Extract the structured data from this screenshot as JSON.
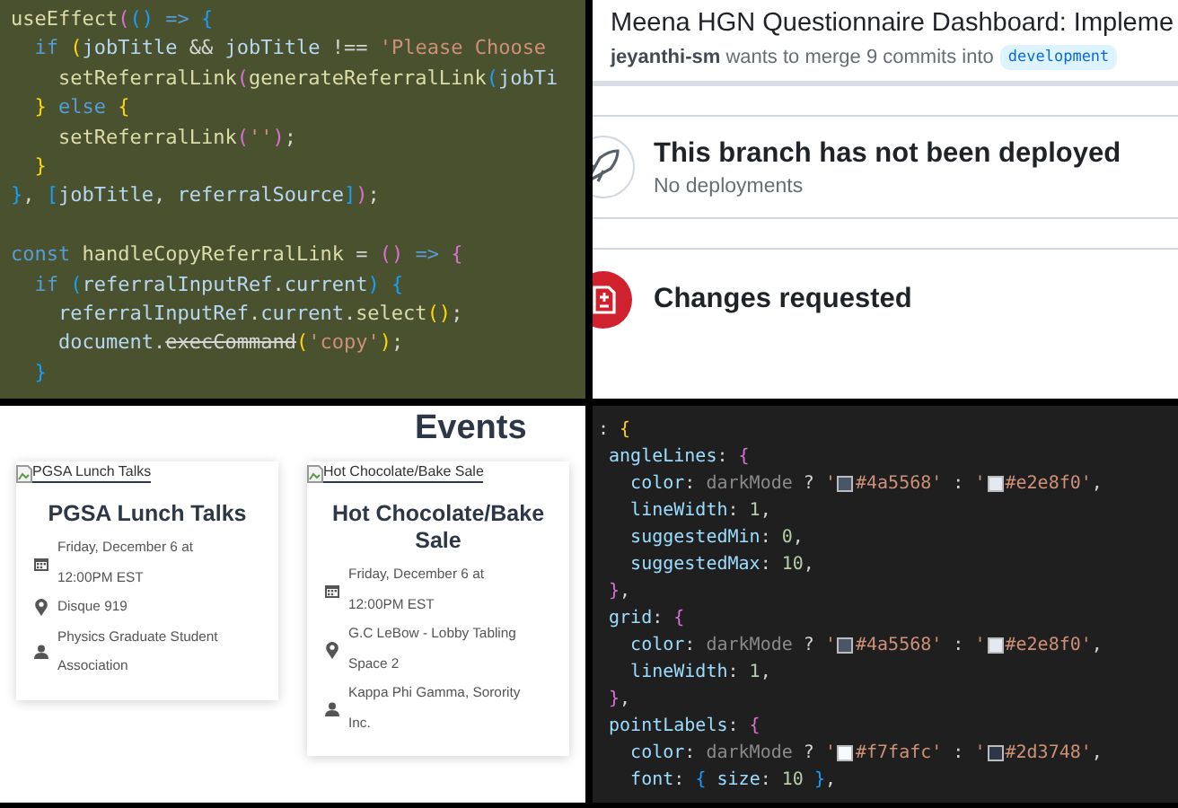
{
  "code_editor_top": {
    "lines": [
      {
        "tokens": [
          {
            "kind": "fn",
            "text": "useEffect"
          },
          {
            "kind": "b2",
            "text": "("
          },
          {
            "kind": "b3",
            "text": "()"
          },
          {
            "kind": "kw",
            "text": " => "
          },
          {
            "kind": "b3",
            "text": "{"
          }
        ]
      },
      {
        "tokens": [
          {
            "kind": "kw",
            "text": "  if "
          },
          {
            "kind": "b1",
            "text": "("
          },
          {
            "kind": "var",
            "text": "jobTitle"
          },
          {
            "kind": "plain",
            "text": " && "
          },
          {
            "kind": "var",
            "text": "jobTitle"
          },
          {
            "kind": "plain",
            "text": " !== "
          },
          {
            "kind": "str",
            "text": "'Please Choose"
          }
        ]
      },
      {
        "tokens": [
          {
            "kind": "fn",
            "text": "    setReferralLink"
          },
          {
            "kind": "b2",
            "text": "("
          },
          {
            "kind": "fn",
            "text": "generateReferralLink"
          },
          {
            "kind": "b3",
            "text": "("
          },
          {
            "kind": "var",
            "text": "jobTi"
          }
        ]
      },
      {
        "tokens": [
          {
            "kind": "b1",
            "text": "  }"
          },
          {
            "kind": "kw",
            "text": " else "
          },
          {
            "kind": "b1",
            "text": "{"
          }
        ]
      },
      {
        "tokens": [
          {
            "kind": "fn",
            "text": "    setReferralLink"
          },
          {
            "kind": "b2",
            "text": "("
          },
          {
            "kind": "str",
            "text": "''"
          },
          {
            "kind": "b2",
            "text": ")"
          },
          {
            "kind": "plain",
            "text": ";"
          }
        ]
      },
      {
        "tokens": [
          {
            "kind": "b1",
            "text": "  }"
          }
        ]
      },
      {
        "tokens": [
          {
            "kind": "b3",
            "text": "}"
          },
          {
            "kind": "plain",
            "text": ", "
          },
          {
            "kind": "b3",
            "text": "["
          },
          {
            "kind": "var",
            "text": "jobTitle"
          },
          {
            "kind": "plain",
            "text": ", "
          },
          {
            "kind": "var",
            "text": "referralSource"
          },
          {
            "kind": "b3",
            "text": "]"
          },
          {
            "kind": "b2",
            "text": ")"
          },
          {
            "kind": "plain",
            "text": ";"
          }
        ]
      },
      {
        "space_before": true,
        "tokens": [
          {
            "kind": "kw",
            "text": "const "
          },
          {
            "kind": "fn",
            "text": "handleCopyReferralLink"
          },
          {
            "kind": "plain",
            "text": " = "
          },
          {
            "kind": "b2",
            "text": "()"
          },
          {
            "kind": "kw",
            "text": " => "
          },
          {
            "kind": "b2",
            "text": "{"
          }
        ]
      },
      {
        "tokens": [
          {
            "kind": "kw",
            "text": "  if "
          },
          {
            "kind": "b3",
            "text": "("
          },
          {
            "kind": "var",
            "text": "referralInputRef"
          },
          {
            "kind": "plain",
            "text": "."
          },
          {
            "kind": "var",
            "text": "current"
          },
          {
            "kind": "b3",
            "text": ")"
          },
          {
            "kind": "b3",
            "text": " {"
          }
        ]
      },
      {
        "tokens": [
          {
            "kind": "var",
            "text": "    referralInputRef"
          },
          {
            "kind": "plain",
            "text": "."
          },
          {
            "kind": "var",
            "text": "current"
          },
          {
            "kind": "plain",
            "text": "."
          },
          {
            "kind": "fn",
            "text": "select"
          },
          {
            "kind": "b1",
            "text": "()"
          },
          {
            "kind": "plain",
            "text": ";"
          }
        ]
      },
      {
        "tokens": [
          {
            "kind": "var",
            "text": "    document"
          },
          {
            "kind": "plain",
            "text": "."
          },
          {
            "kind": "deprecated",
            "text": "execCommand"
          },
          {
            "kind": "b1",
            "text": "("
          },
          {
            "kind": "str",
            "text": "'copy'"
          },
          {
            "kind": "b1",
            "text": ")"
          },
          {
            "kind": "plain",
            "text": ";"
          }
        ]
      },
      {
        "tokens": [
          {
            "kind": "b3",
            "text": "  }"
          }
        ]
      }
    ]
  },
  "pull_request": {
    "title": "Meena HGN Questionnaire Dashboard: Impleme",
    "author": "jeyanthi-sm",
    "merge_text": "wants to merge 9 commits into",
    "branch": "development",
    "sections": [
      {
        "kind": "deploy",
        "title": "This branch has not been deployed",
        "subtitle": "No deployments"
      },
      {
        "kind": "changes",
        "title": "Changes requested"
      }
    ]
  },
  "events": {
    "heading": "Events",
    "cards": [
      {
        "image_alt": "PGSA Lunch Talks",
        "title": "PGSA Lunch Talks",
        "details": [
          {
            "kind": "date",
            "text": "Friday, December 6 at 12:00PM EST"
          },
          {
            "kind": "location",
            "text": "Disque 919"
          },
          {
            "kind": "host",
            "text": "Physics Graduate Student Association"
          }
        ]
      },
      {
        "image_alt": "Hot Chocolate/Bake Sale",
        "title": "Hot Chocolate/Bake Sale",
        "details": [
          {
            "kind": "date",
            "text": "Friday, December 6 at 12:00PM EST"
          },
          {
            "kind": "location",
            "text": "G.C LeBow - Lobby Tabling Space 2"
          },
          {
            "kind": "host",
            "text": "Kappa Phi Gamma, Sorority Inc."
          }
        ]
      }
    ]
  },
  "code_editor_bottom": {
    "lines": [
      {
        "tokens": [
          {
            "kind": "plain",
            "text": ": "
          },
          {
            "kind": "b1",
            "text": "{"
          }
        ]
      },
      {
        "tokens": [
          {
            "kind": "var",
            "text": " angleLines"
          },
          {
            "kind": "plain",
            "text": ": "
          },
          {
            "kind": "b2",
            "text": "{"
          }
        ]
      },
      {
        "tokens": [
          {
            "kind": "var",
            "text": "   color"
          },
          {
            "kind": "plain",
            "text": ": "
          },
          {
            "kind": "dim",
            "text": "darkMode"
          },
          {
            "kind": "plain",
            "text": " ? "
          },
          {
            "kind": "str",
            "text": "'"
          },
          {
            "kind": "swatch",
            "color": "#4a5568"
          },
          {
            "kind": "str",
            "text": "#4a5568'"
          },
          {
            "kind": "plain",
            "text": " : "
          },
          {
            "kind": "str",
            "text": "'"
          },
          {
            "kind": "swatch",
            "color": "#e2e8f0"
          },
          {
            "kind": "str",
            "text": "#e2e8f0'"
          },
          {
            "kind": "plain",
            "text": ","
          }
        ]
      },
      {
        "tokens": [
          {
            "kind": "var",
            "text": "   lineWidth"
          },
          {
            "kind": "plain",
            "text": ": "
          },
          {
            "kind": "num",
            "text": "1"
          },
          {
            "kind": "plain",
            "text": ","
          }
        ]
      },
      {
        "tokens": [
          {
            "kind": "var",
            "text": "   suggestedMin"
          },
          {
            "kind": "plain",
            "text": ": "
          },
          {
            "kind": "num",
            "text": "0"
          },
          {
            "kind": "plain",
            "text": ","
          }
        ]
      },
      {
        "tokens": [
          {
            "kind": "var",
            "text": "   suggestedMax"
          },
          {
            "kind": "plain",
            "text": ": "
          },
          {
            "kind": "num",
            "text": "10"
          },
          {
            "kind": "plain",
            "text": ","
          }
        ]
      },
      {
        "tokens": [
          {
            "kind": "b2",
            "text": " }"
          },
          {
            "kind": "plain",
            "text": ","
          }
        ]
      },
      {
        "tokens": [
          {
            "kind": "var",
            "text": " grid"
          },
          {
            "kind": "plain",
            "text": ": "
          },
          {
            "kind": "b2",
            "text": "{"
          }
        ]
      },
      {
        "tokens": [
          {
            "kind": "var",
            "text": "   color"
          },
          {
            "kind": "plain",
            "text": ": "
          },
          {
            "kind": "dim",
            "text": "darkMode"
          },
          {
            "kind": "plain",
            "text": " ? "
          },
          {
            "kind": "str",
            "text": "'"
          },
          {
            "kind": "swatch",
            "color": "#4a5568"
          },
          {
            "kind": "str",
            "text": "#4a5568'"
          },
          {
            "kind": "plain",
            "text": " : "
          },
          {
            "kind": "str",
            "text": "'"
          },
          {
            "kind": "swatch",
            "color": "#e2e8f0"
          },
          {
            "kind": "str",
            "text": "#e2e8f0'"
          },
          {
            "kind": "plain",
            "text": ","
          }
        ]
      },
      {
        "tokens": [
          {
            "kind": "var",
            "text": "   lineWidth"
          },
          {
            "kind": "plain",
            "text": ": "
          },
          {
            "kind": "num",
            "text": "1"
          },
          {
            "kind": "plain",
            "text": ","
          }
        ]
      },
      {
        "tokens": [
          {
            "kind": "b2",
            "text": " }"
          },
          {
            "kind": "plain",
            "text": ","
          }
        ]
      },
      {
        "tokens": [
          {
            "kind": "var",
            "text": " pointLabels"
          },
          {
            "kind": "plain",
            "text": ": "
          },
          {
            "kind": "b2",
            "text": "{"
          }
        ]
      },
      {
        "tokens": [
          {
            "kind": "var",
            "text": "   color"
          },
          {
            "kind": "plain",
            "text": ": "
          },
          {
            "kind": "dim",
            "text": "darkMode"
          },
          {
            "kind": "plain",
            "text": " ? "
          },
          {
            "kind": "str",
            "text": "'"
          },
          {
            "kind": "swatch",
            "color": "#f7fafc"
          },
          {
            "kind": "str",
            "text": "#f7fafc'"
          },
          {
            "kind": "plain",
            "text": " : "
          },
          {
            "kind": "str",
            "text": "'"
          },
          {
            "kind": "swatch",
            "color": "#2d3748"
          },
          {
            "kind": "str",
            "text": "#2d3748'"
          },
          {
            "kind": "plain",
            "text": ","
          }
        ]
      },
      {
        "tokens": [
          {
            "kind": "var",
            "text": "   font"
          },
          {
            "kind": "plain",
            "text": ": "
          },
          {
            "kind": "b3",
            "text": "{"
          },
          {
            "kind": "var",
            "text": " size"
          },
          {
            "kind": "plain",
            "text": ": "
          },
          {
            "kind": "num",
            "text": "10"
          },
          {
            "kind": "b3",
            "text": " }"
          },
          {
            "kind": "plain",
            "text": ","
          }
        ]
      }
    ]
  }
}
